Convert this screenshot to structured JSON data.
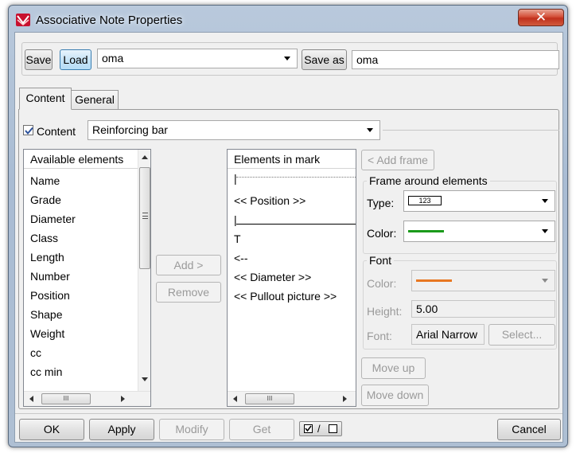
{
  "window": {
    "title": "Associative Note Properties",
    "close_glyph": "✕"
  },
  "toolbar": {
    "save_label": "Save",
    "load_label": "Load",
    "load_combo_value": "oma",
    "save_as_label": "Save as",
    "save_as_value": "oma"
  },
  "tabs": [
    {
      "label": "Content",
      "active": true
    },
    {
      "label": "General",
      "active": false
    }
  ],
  "content_row": {
    "checkbox_label": "Content",
    "checked": true,
    "combo_value": "Reinforcing bar"
  },
  "available": {
    "header": "Available elements",
    "items": [
      "Name",
      "Grade",
      "Diameter",
      "Class",
      "Length",
      "Number",
      "Position",
      "Shape",
      "Weight",
      "cc",
      "cc min"
    ]
  },
  "middle_buttons": {
    "add": "Add >",
    "remove": "Remove"
  },
  "in_mark": {
    "header": "Elements in mark",
    "items": [
      "|",
      "<< Position >>",
      "|",
      "T",
      "<--",
      "<< Diameter >>",
      "<< Pullout picture >>"
    ]
  },
  "frame": {
    "add_frame_label": "< Add frame",
    "group_label": "Frame around elements",
    "type_label": "Type:",
    "type_preview_text": "123",
    "color_label": "Color:",
    "color_value": "#1a9a1a"
  },
  "font": {
    "group_label": "Font",
    "color_label": "Color:",
    "color_value": "#e87722",
    "height_label": "Height:",
    "height_value": "5.00",
    "font_label": "Font:",
    "font_value": "Arial Narrow",
    "select_label": "Select..."
  },
  "move": {
    "up": "Move up",
    "down": "Move down"
  },
  "bottom": {
    "ok": "OK",
    "apply": "Apply",
    "modify": "Modify",
    "get": "Get",
    "toggle_glyph": "/",
    "cancel": "Cancel"
  },
  "scroll_glyph": "III",
  "colors": {
    "accent": "#3c7fb1"
  }
}
